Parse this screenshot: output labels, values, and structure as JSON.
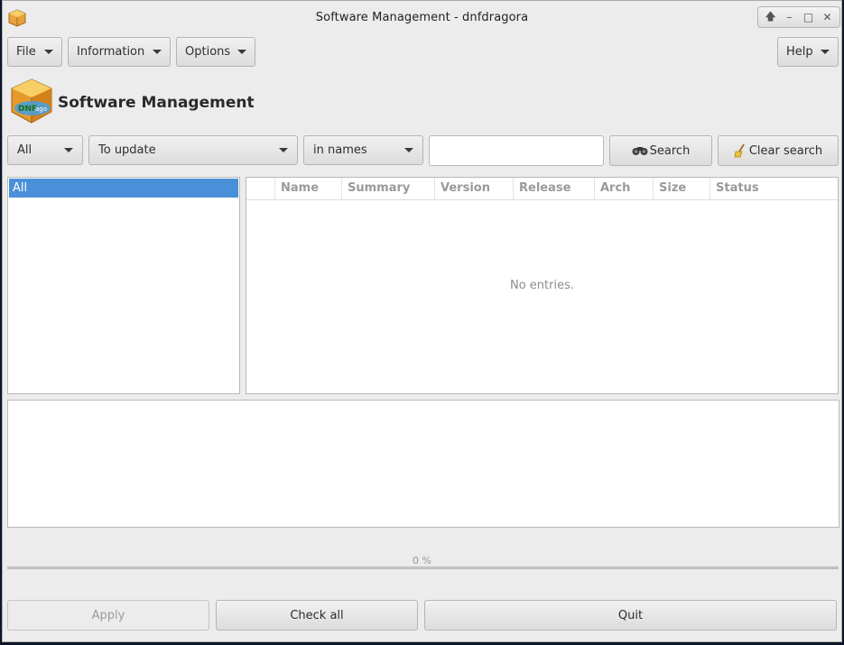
{
  "window": {
    "title": "Software Management - dnfdragora"
  },
  "wm": {
    "up": "🡅",
    "minimize": "–",
    "maximize": "□",
    "close": "✕"
  },
  "menubar": {
    "file": "File",
    "information": "Information",
    "options": "Options",
    "help": "Help"
  },
  "header": {
    "title": "Software Management",
    "icon": "dnfdragora-box-icon"
  },
  "filters": {
    "group_filter": "All",
    "status_filter": "To update",
    "search_scope": "in names",
    "search_value": "",
    "search_label": "Search",
    "clear_label": "Clear search"
  },
  "groups": {
    "items": [
      "All"
    ],
    "selected": "All"
  },
  "packages": {
    "columns": [
      "Name",
      "Summary",
      "Version",
      "Release",
      "Arch",
      "Size",
      "Status"
    ],
    "rows": [],
    "empty_text": "No entries."
  },
  "progress": {
    "label": "0 %",
    "value": 0
  },
  "footer": {
    "apply": "Apply",
    "check_all": "Check all",
    "quit": "Quit"
  },
  "colors": {
    "accent": "#4a90d9",
    "background": "#ececec"
  }
}
